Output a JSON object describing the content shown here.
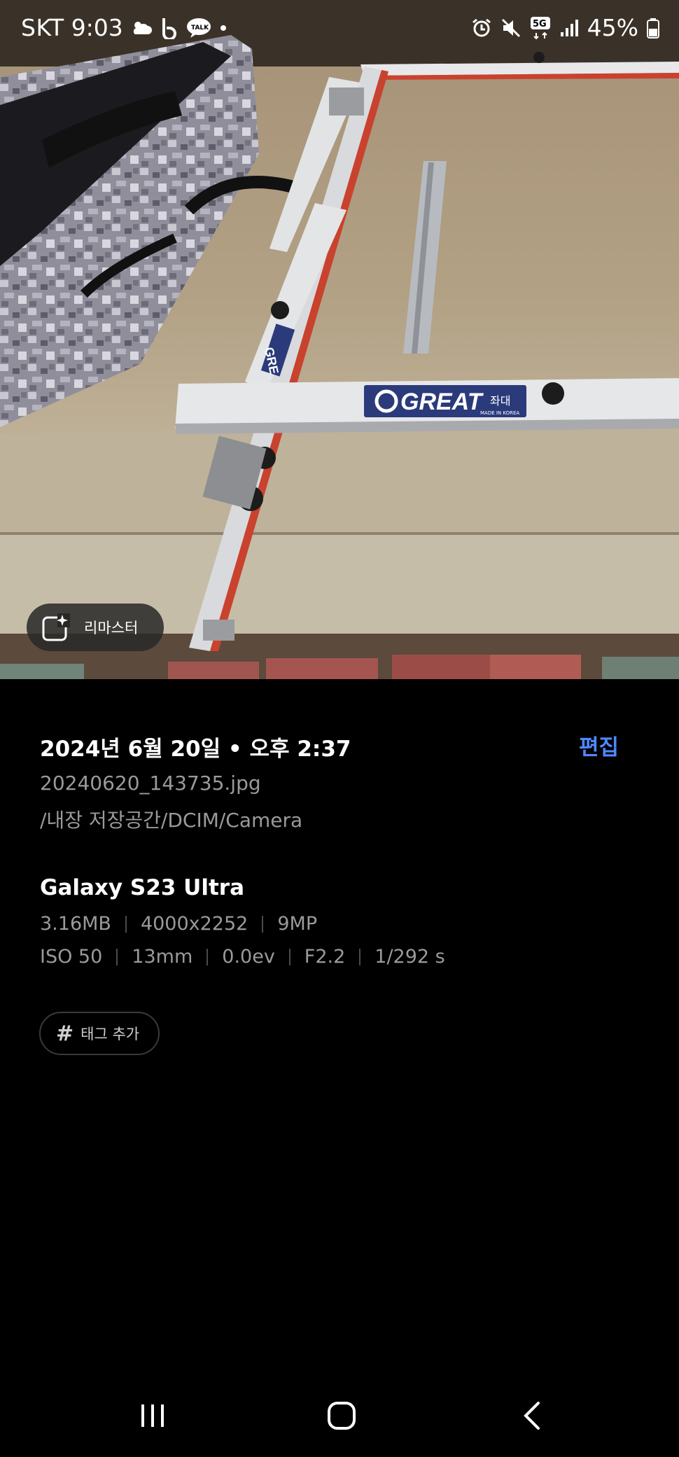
{
  "status_bar": {
    "carrier": "SKT",
    "time": "9:03",
    "network": "5G",
    "battery_percent": "45%",
    "icons": [
      "cloud-sun-icon",
      "b-app-icon",
      "kakaotalk-icon",
      "dot-icon",
      "alarm-icon",
      "mute-icon",
      "5g-icon",
      "signal-icon",
      "battery-icon"
    ]
  },
  "photo": {
    "remaster_label": "리마스터",
    "sign_text": "GREAT",
    "sign_suffix": "좌대",
    "sign_small": "MADE IN KOREA",
    "sign_text_partial": "GRE"
  },
  "details": {
    "date_time": "2024년 6월 20일 • 오후 2:37",
    "edit_label": "편집",
    "filename": "20240620_143735.jpg",
    "path": "/내장 저장공간/DCIM/Camera",
    "device": "Galaxy S23 Ultra",
    "file_info": [
      "3.16MB",
      "4000x2252",
      "9MP"
    ],
    "camera_info": [
      "ISO 50",
      "13mm",
      "0.0ev",
      "F2.2",
      "1/292 s"
    ],
    "tag_label": "태그 추가"
  },
  "navigation": [
    "recent-apps",
    "home",
    "back"
  ],
  "colors": {
    "accent": "#4f88ff",
    "background": "#000000",
    "secondary_text": "#9a9a9a"
  }
}
